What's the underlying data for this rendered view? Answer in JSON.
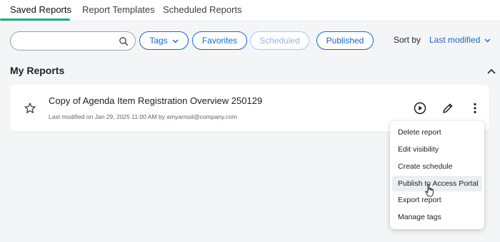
{
  "tabs": [
    {
      "label": "Saved Reports",
      "active": true
    },
    {
      "label": "Report Templates",
      "active": false
    },
    {
      "label": "Scheduled Reports",
      "active": false
    }
  ],
  "filters": {
    "search_placeholder": "",
    "search_value": "",
    "tags_label": "Tags",
    "favorites_label": "Favorites",
    "scheduled_label": "Scheduled",
    "published_label": "Published",
    "sort_label": "Sort by",
    "sort_value": "Last modified"
  },
  "section": {
    "title": "My Reports"
  },
  "report": {
    "title": "Copy of Agenda Item Registration Overview 250129",
    "meta": "Last modified on Jan 29, 2025 11:00 AM by amyarnod@company.com"
  },
  "menu": {
    "items": [
      {
        "label": "Delete report"
      },
      {
        "label": "Edit visibility"
      },
      {
        "label": "Create schedule"
      },
      {
        "label": "Publish to Access Portal",
        "hovered": true
      },
      {
        "label": "Export report"
      },
      {
        "label": "Manage tags"
      }
    ]
  },
  "colors": {
    "accent": "#1668c7",
    "tab_underline": "#1aaf7e",
    "background": "#f4f5f7"
  },
  "icons": [
    "search-icon",
    "chevron-down-icon",
    "chevron-up-icon",
    "star-icon",
    "play-icon",
    "pencil-icon",
    "more-vertical-icon",
    "hand-cursor-icon"
  ]
}
